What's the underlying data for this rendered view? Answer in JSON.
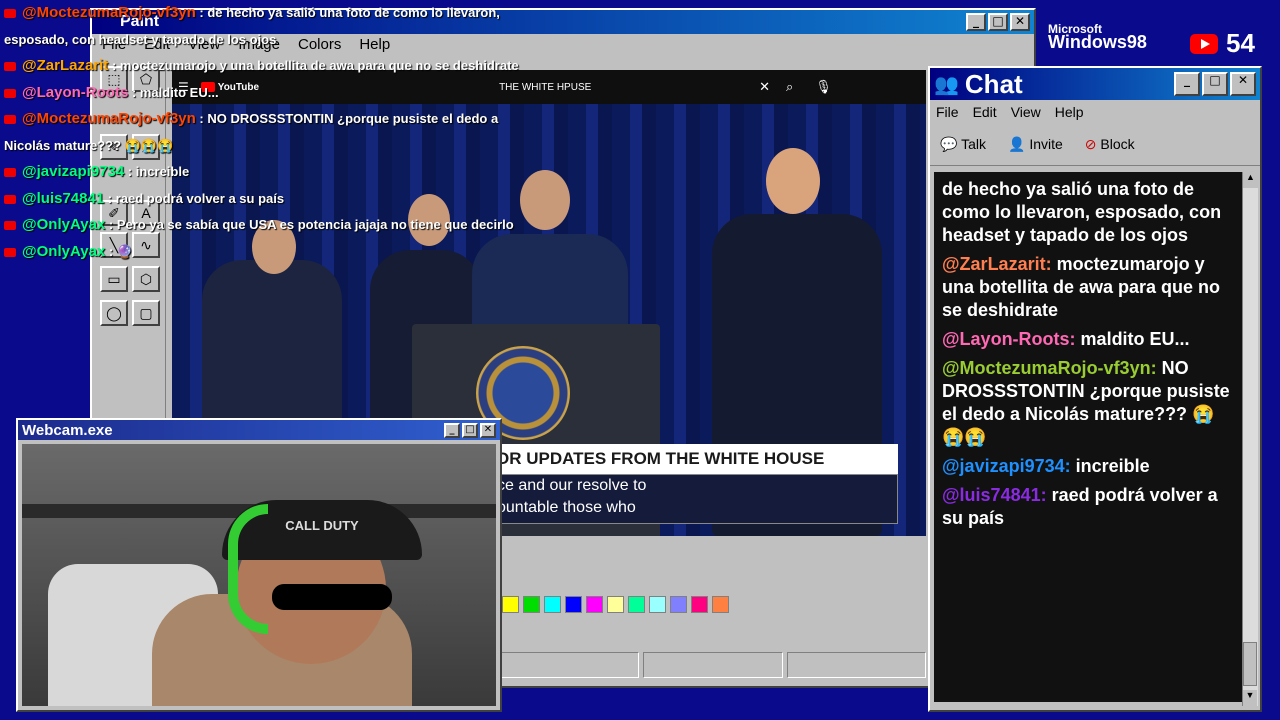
{
  "branding": {
    "ms_label": "Microsoft",
    "windows_label": "Windows98",
    "viewer_count": "54"
  },
  "paint": {
    "title": "Paint",
    "menus": [
      "File",
      "Edit",
      "View",
      "Image",
      "Colors",
      "Help"
    ],
    "palette": [
      "#ffff00",
      "#00dd00",
      "#00ffff",
      "#0000ff",
      "#ff00ff",
      "#ffff99",
      "#00ff99",
      "#99ffff",
      "#8080ff",
      "#ff0080",
      "#ff8040"
    ]
  },
  "video": {
    "yt_logo": "YouTube",
    "search_text": "THE WHITE HPUSE",
    "lower_third_title": "OR UPDATES FROM THE WHITE HOUSE",
    "caption_line1": "ce and our resolve to",
    "caption_line2": "ountable those who"
  },
  "chat_window": {
    "title": "Chat",
    "menus": [
      "File",
      "Edit",
      "View",
      "Help"
    ],
    "tools": [
      {
        "label": "Talk",
        "icon": "talk-icon"
      },
      {
        "label": "Invite",
        "icon": "invite-icon"
      },
      {
        "label": "Block",
        "icon": "block-icon"
      }
    ],
    "messages": [
      {
        "user": "",
        "color": "#ffffff",
        "text": "de hecho ya salió una foto de como lo llevaron, esposado, con headset y tapado de los ojos"
      },
      {
        "user": "@ZarLazarit:",
        "color": "#ff7f50",
        "text": "moctezumarojo y una botellita de awa para que no se deshidrate"
      },
      {
        "user": "@Layon-Roots:",
        "color": "#ff69b4",
        "text": "maldito EU..."
      },
      {
        "user": "@MoctezumaRojo-vf3yn:",
        "color": "#9acd32",
        "text": "NO DROSSSTONTIN ¿porque pusiste el dedo a Nicolás mature??? 😭😭😭"
      },
      {
        "user": "@javizapi9734:",
        "color": "#1e90ff",
        "text": "increible"
      },
      {
        "user": "@luis74841:",
        "color": "#8a2be2",
        "text": "raed podrá volver a su país"
      }
    ]
  },
  "overlay_chat": [
    {
      "user": "@MoctezumaRojo-vf3yn",
      "color": "#ff4500",
      "text": ": de hecho ya salió una foto de como lo llevaron,"
    },
    {
      "user": "",
      "color": "#ffffff",
      "text": "esposado, con headset y tapado de los ojos"
    },
    {
      "user": "@ZarLazarit",
      "color": "#ffa500",
      "text": ": moctezumarojo y una botellita de awa para que no se deshidrate"
    },
    {
      "user": "@Layon-Roots",
      "color": "#ff69b4",
      "text": ": maldito EU..."
    },
    {
      "user": "@MoctezumaRojo-vf3yn",
      "color": "#ff4500",
      "text": ": NO DROSSSTONTIN ¿porque pusiste el dedo a"
    },
    {
      "user": "",
      "color": "#ffffff",
      "text": "Nicolás mature??? 😭😭😭"
    },
    {
      "user": "@javizapi9734",
      "color": "#00ff7f",
      "text": ": increible"
    },
    {
      "user": "@luis74841",
      "color": "#00ff7f",
      "text": ": raed podrá volver a su país"
    },
    {
      "user": "@OnlyAyax",
      "color": "#00ff7f",
      "text": ": Pero ya se sabía que USA es potencia jajaja no tiene que decirlo"
    },
    {
      "user": "@OnlyAyax",
      "color": "#00ff7f",
      "text": ": 🔮"
    }
  ],
  "webcam": {
    "title": "Webcam.exe",
    "cap_text": "CALL DUTY"
  }
}
